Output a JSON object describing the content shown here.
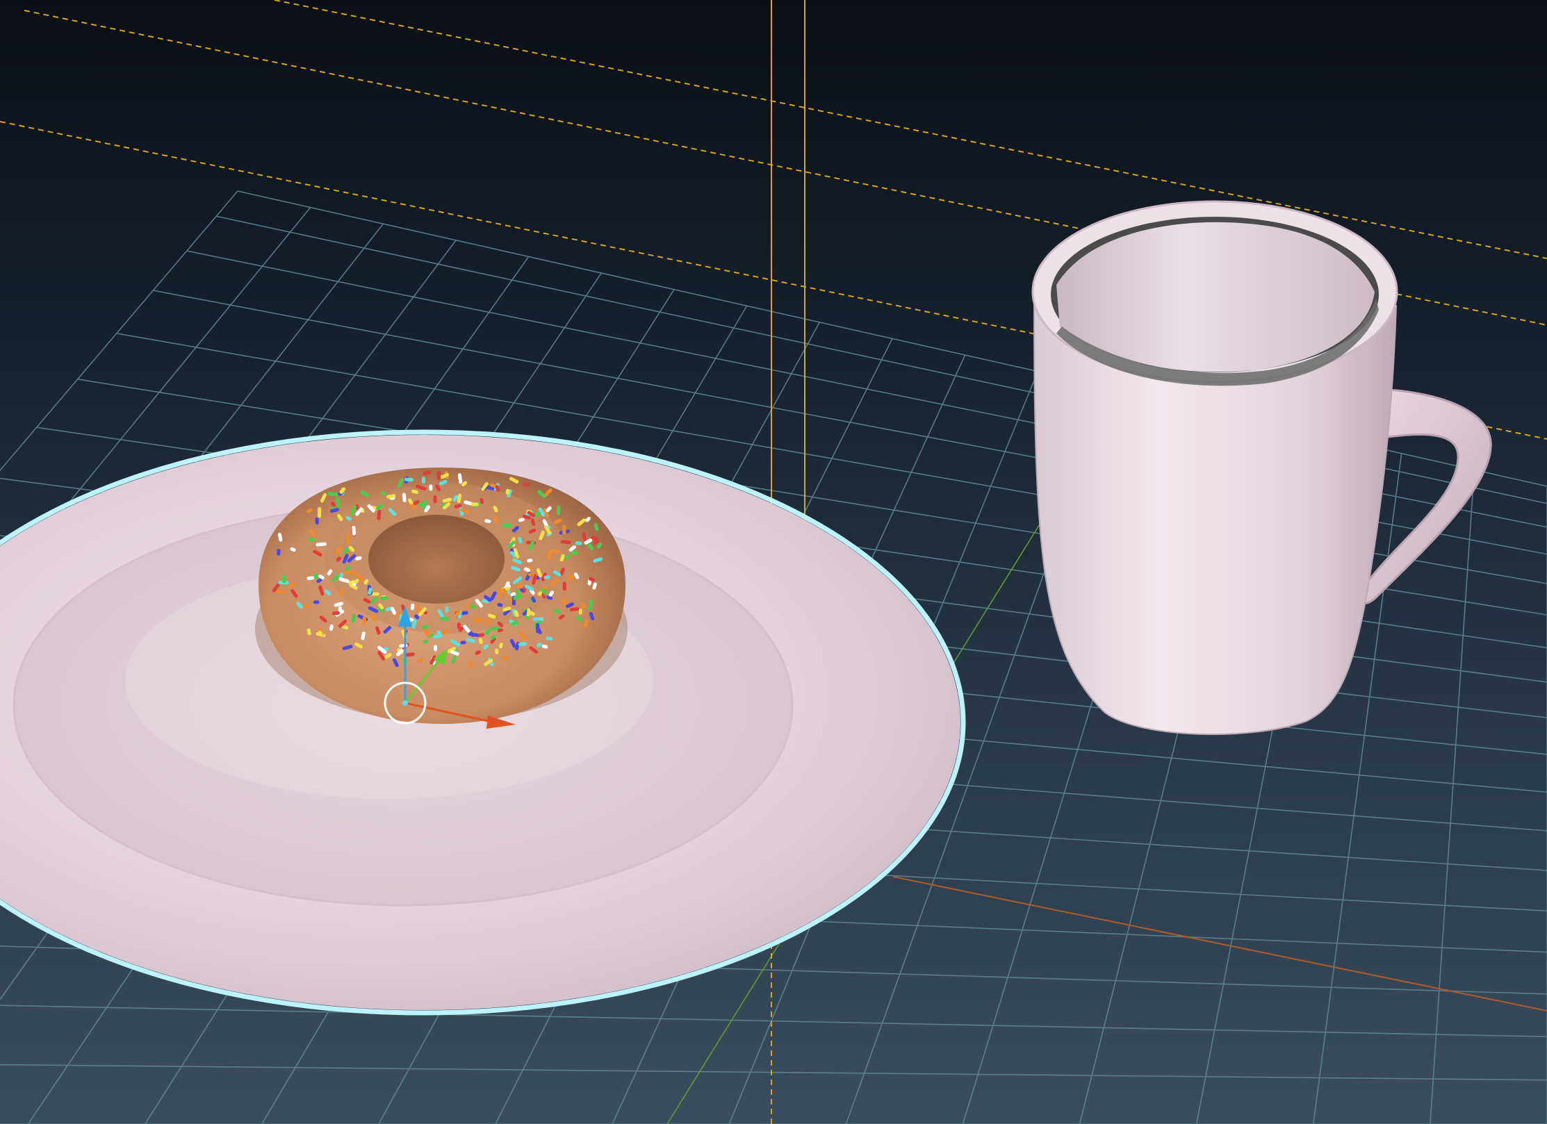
{
  "viewport": {
    "mode": "3d-viewport",
    "background_top": "#0b0f16",
    "background_bottom": "#3a4d5e",
    "grid_color": "#5d8c95",
    "x_axis_color": "#b25a2a",
    "y_axis_color": "#5e9a2f",
    "guide_line_color": "#d9a520"
  },
  "scene": {
    "objects": [
      {
        "name": "plate",
        "selected": true,
        "color": "#e6d6de",
        "outline_color": "#bdf3ff"
      },
      {
        "name": "donut",
        "selected": false,
        "dough_color": "#c98b62",
        "sprinkle_colors": [
          "#e23d3d",
          "#4ccc4c",
          "#f2e14a",
          "#5fe0e0",
          "#4a4adf",
          "#ffffff",
          "#f08a2a"
        ]
      },
      {
        "name": "mug",
        "selected": false,
        "color": "#e6d6de",
        "rim_inner_color": "#4b4b4b"
      }
    ]
  },
  "gizmo": {
    "x_color": "#e0521e",
    "y_color": "#66cc33",
    "z_color": "#2aa7e6",
    "pivot_color": "#ffffff"
  }
}
